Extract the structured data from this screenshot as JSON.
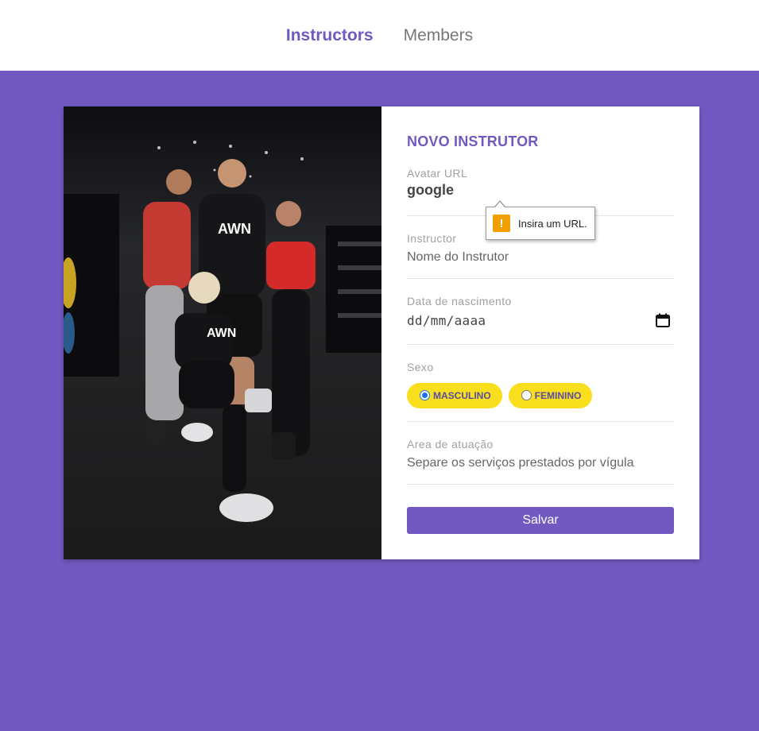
{
  "nav": {
    "instructors_label": "Instructors",
    "members_label": "Members"
  },
  "form": {
    "title": "NOVO INSTRUTOR",
    "avatar": {
      "label": "Avatar URL",
      "value": "google"
    },
    "instructor": {
      "label": "Instructor",
      "placeholder": "Nome do Instrutor"
    },
    "birth": {
      "label": "Data de nascimento",
      "placeholder": "dd/mm/aaaa"
    },
    "gender": {
      "label": "Sexo",
      "options": [
        {
          "label": "MASCULINO",
          "checked": true
        },
        {
          "label": "FEMININO",
          "checked": false
        }
      ]
    },
    "services": {
      "label": "Area de atuação",
      "placeholder": "Separe os serviços prestados por vígula"
    },
    "save_label": "Salvar"
  },
  "tooltip": {
    "message": "Insira um URL.",
    "icon": "warning-icon"
  },
  "colors": {
    "brand": "#7159c1",
    "pill": "#f7df1e",
    "warning": "#f29d00"
  }
}
